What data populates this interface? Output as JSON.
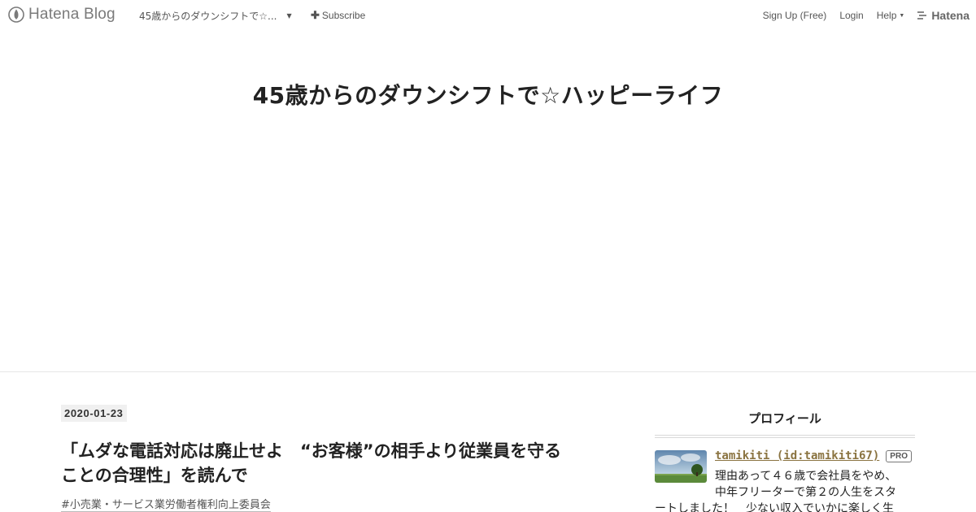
{
  "topbar": {
    "brand": "Hatena Blog",
    "blog_selector": "45歳からのダウンシフトで☆...",
    "subscribe": "Subscribe",
    "signup": "Sign Up (Free)",
    "login": "Login",
    "help": "Help",
    "hatena": "Hatena"
  },
  "blog": {
    "title": "45歳からのダウンシフトで☆ハッピーライフ"
  },
  "entry": {
    "date": "2020-01-23",
    "title_line1": "「ムダな電話対応は廃止せよ　“お客様”の相手より従業員を守る",
    "title_line2": "ことの合理性」を読んで",
    "category": "#小売業・サービス業労働者権利向上委員会"
  },
  "sidebar": {
    "profile_title": "プロフィール",
    "username": "tamikiti (id:tamikiti67)",
    "badge": "PRO",
    "desc_line1": "理由あって４６歳で会社員をやめ、",
    "desc_line2": "中年フリーターで第２の人生をスタ",
    "desc_line3": "ートしました！　少ない収入でいかに楽しく生"
  },
  "colors": {
    "profile_link": "#8a7340",
    "date_badge_bg": "#f0f0f0"
  },
  "icons": {
    "brand": "hatena-blog-pen-icon",
    "subscribe": "plus-icon",
    "dropdown": "caret-down-icon",
    "hatena": "hatena-logo-icon"
  }
}
